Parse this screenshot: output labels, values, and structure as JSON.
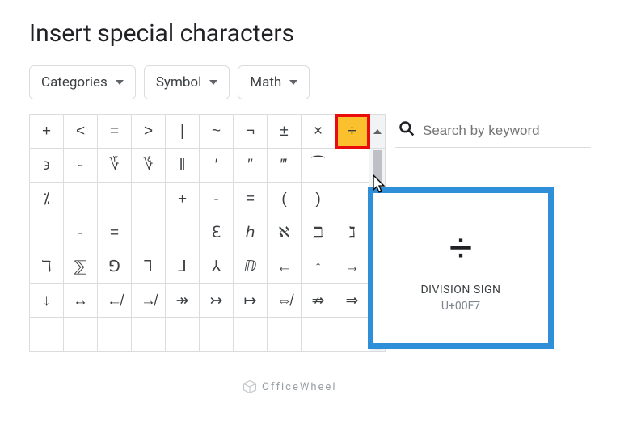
{
  "title": "Insert special characters",
  "dropdowns": {
    "categories": "Categories",
    "symbol": "Symbol",
    "math": "Math"
  },
  "search": {
    "placeholder": "Search by keyword"
  },
  "tooltip": {
    "glyph": "÷",
    "name": "DIVISION SIGN",
    "code": "U+00F7"
  },
  "watermark": "OfficeWheel",
  "grid": {
    "rows": [
      [
        "+",
        "<",
        "=",
        ">",
        "|",
        "~",
        "¬",
        "±",
        "×",
        "÷"
      ],
      [
        "϶",
        "֊",
        "؆",
        "؇",
        "‖",
        "′",
        "″",
        "‴",
        "⁀",
        ""
      ],
      [
        "⁒",
        "",
        "",
        "",
        "+",
        "-",
        "=",
        "(",
        ")",
        ""
      ],
      [
        "",
        "-",
        "=",
        "",
        "",
        "ℇ",
        "ℎ",
        "ℵ",
        "ℶ",
        "ℷ"
      ],
      [
        "ℸ",
        "⅀",
        "⅁",
        "⅂",
        "⅃",
        "⅄",
        "ⅅ",
        "←",
        "↑",
        "→"
      ],
      [
        "↓",
        "↔",
        "↚",
        "↛",
        "↠",
        "↣",
        "↦",
        "⇎",
        "⇏",
        "⇒"
      ],
      [
        "",
        "",
        "",
        "",
        "",
        "",
        "",
        "",
        "",
        ""
      ]
    ],
    "selected": {
      "row": 0,
      "col": 9
    }
  }
}
